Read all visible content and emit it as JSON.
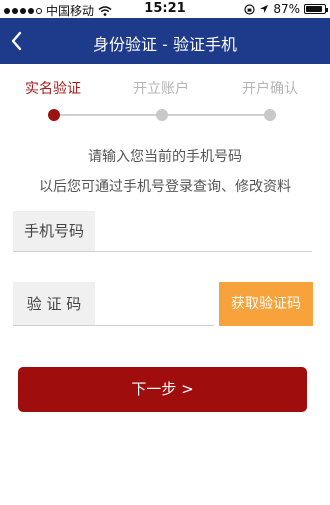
{
  "status_bar": {
    "carrier": "中国移动",
    "time": "15:21",
    "battery_percent": "87%",
    "battery_level": 0.87,
    "signal_dots_filled": 4,
    "signal_dots_total": 5
  },
  "nav": {
    "back_icon": "‹",
    "title": "身份验证 - 验证手机"
  },
  "steps": [
    {
      "label": "实名验证",
      "active": true
    },
    {
      "label": "开立账户",
      "active": false
    },
    {
      "label": "开户确认",
      "active": false
    }
  ],
  "hints": {
    "line1": "请输入您当前的手机号码",
    "line2": "以后您可通过手机号登录查询、修改资料"
  },
  "form": {
    "phone_label": "手机号码",
    "phone_value": "",
    "code_label": "验 证 码",
    "code_value": "",
    "get_code_button": "获取验证码"
  },
  "next_button": "下一步 >",
  "colors": {
    "nav_bg": "#1e3a8a",
    "accent_red": "#a00d0d",
    "code_button": "#f7a23b"
  }
}
